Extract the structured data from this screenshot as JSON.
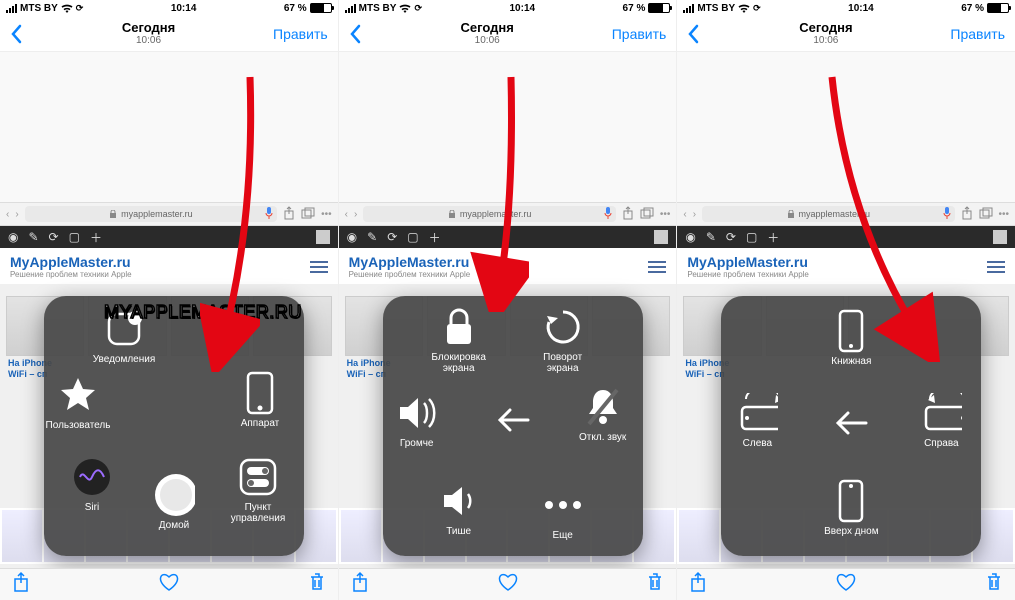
{
  "status": {
    "carrier": "MTS BY",
    "time": "10:14",
    "battery": "67 %"
  },
  "nav": {
    "title": "Сегодня",
    "subtitle": "10:06",
    "edit": "Править"
  },
  "safari": {
    "url": "myapplemaster.ru"
  },
  "site": {
    "title": "MyAppleMaster.ru",
    "tagline": "Решение проблем техники Apple"
  },
  "article": {
    "snippet_title": "На iPhone",
    "snippet_line2": "WiFi – сп"
  },
  "watermark": "MYAPPLEMASTER.RU",
  "panels": {
    "a": [
      {
        "name": "notifications",
        "label": "Уведомления",
        "icon": "app-badge"
      },
      {
        "name": "user",
        "label": "Пользователь",
        "icon": "star"
      },
      {
        "name": "device",
        "label": "Аппарат",
        "icon": "phone"
      },
      {
        "name": "siri",
        "label": "Siri",
        "icon": "siri"
      },
      {
        "name": "home",
        "label": "Домой",
        "icon": "home-circle"
      },
      {
        "name": "control-center",
        "label": "Пункт\nуправления",
        "icon": "switches"
      }
    ],
    "b": [
      {
        "name": "lock-screen",
        "label": "Блокировка\nэкрана",
        "icon": "lock"
      },
      {
        "name": "rotate-screen",
        "label": "Поворот\nэкрана",
        "icon": "rotate"
      },
      {
        "name": "volume-up",
        "label": "Громче",
        "icon": "vol-up"
      },
      {
        "name": "back",
        "label": "",
        "icon": "arrow-left"
      },
      {
        "name": "mute",
        "label": "Откл. звук",
        "icon": "bell-off"
      },
      {
        "name": "volume-down",
        "label": "Тише",
        "icon": "vol-down"
      },
      {
        "name": "more",
        "label": "Еще",
        "icon": "dots"
      }
    ],
    "c": [
      {
        "name": "portrait",
        "label": "Книжная",
        "icon": "phone-v"
      },
      {
        "name": "landscape-left",
        "label": "Слева",
        "icon": "phone-h-l"
      },
      {
        "name": "back",
        "label": "",
        "icon": "arrow-left"
      },
      {
        "name": "landscape-right",
        "label": "Справа",
        "icon": "phone-h-r"
      },
      {
        "name": "upside-down",
        "label": "Вверх дном",
        "icon": "phone-v-flip"
      }
    ]
  }
}
